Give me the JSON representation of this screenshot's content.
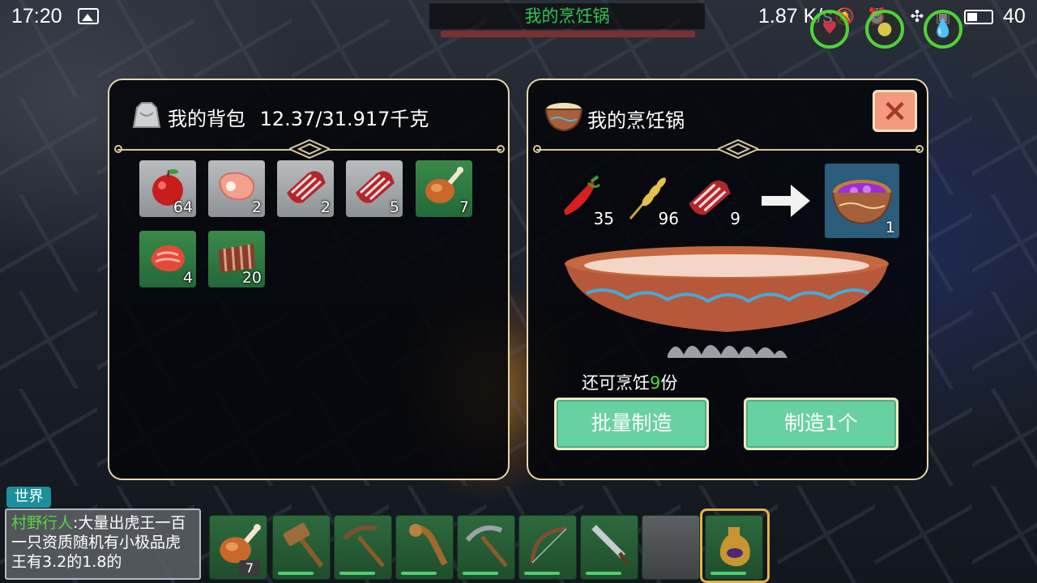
{
  "status_bar": {
    "time": "17:20",
    "network_speed": "1.87 K/s",
    "battery_level": "40",
    "icons": [
      "image-icon",
      "mute-icon",
      "alarm-icon",
      "wifi-icon",
      "sim-icon",
      "battery-icon"
    ]
  },
  "top_banner": {
    "title": "我的烹饪锅"
  },
  "backpack_panel": {
    "title": "我的背包",
    "weight": "12.37/31.917千克",
    "items": [
      {
        "name": "apple",
        "count": "64",
        "bg": "grey"
      },
      {
        "name": "pork-chop",
        "count": "2",
        "bg": "grey"
      },
      {
        "name": "raw-meat",
        "count": "2",
        "bg": "grey"
      },
      {
        "name": "raw-meat",
        "count": "5",
        "bg": "grey"
      },
      {
        "name": "drumstick",
        "count": "7",
        "bg": "green"
      },
      {
        "name": "sliced-meat",
        "count": "4",
        "bg": "green"
      },
      {
        "name": "ribs",
        "count": "20",
        "bg": "green"
      }
    ]
  },
  "cooking_panel": {
    "title": "我的烹饪锅",
    "close_label": "×",
    "ingredients": [
      {
        "name": "chili-pepper",
        "count": "35"
      },
      {
        "name": "wheat",
        "count": "96"
      },
      {
        "name": "raw-meat",
        "count": "9"
      }
    ],
    "result": {
      "name": "purple-stew",
      "count": "1"
    },
    "remaining_prefix": "还可烹饪",
    "remaining_count": "9",
    "remaining_suffix": "份",
    "batch_button": "批量制造",
    "make_one_button": "制造1个"
  },
  "chat": {
    "channel": "世界",
    "sender": "村野行人",
    "message": ":大量出虎王一百一只资质随机有小极品虎王有3.2的1.8的"
  },
  "hotbar": [
    {
      "name": "drumstick",
      "count": "7"
    },
    {
      "name": "hammer"
    },
    {
      "name": "pickaxe-wood"
    },
    {
      "name": "war-club"
    },
    {
      "name": "pickaxe-iron"
    },
    {
      "name": "bow"
    },
    {
      "name": "sword"
    },
    {
      "name": "empty"
    },
    {
      "name": "water-flask",
      "selected": true
    }
  ],
  "colors": {
    "panel_border": "#e8d7ae",
    "button": "#68d1a0",
    "accent_green": "#52d63a",
    "close_button": "#f39a7e"
  }
}
